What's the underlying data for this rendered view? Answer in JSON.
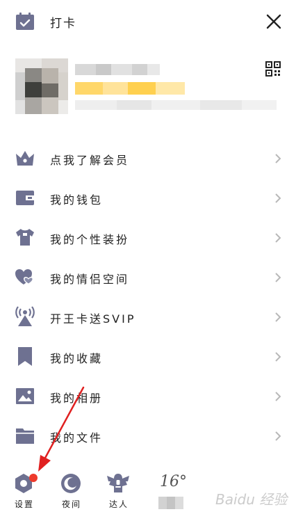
{
  "colors": {
    "icon": "#6e7191",
    "icon_light": "#8a8eab",
    "text": "#222222",
    "chevron": "#b8b8b8",
    "vip_gold": "#ffd76a",
    "badge_red": "#ee3a2c",
    "annotation_arrow": "#e02020"
  },
  "header": {
    "checkin_label": "打卡",
    "checkin_icon": "calendar-check-icon",
    "close_icon": "close-icon",
    "qr_icon": "qr-code-icon"
  },
  "menu": {
    "items": [
      {
        "label": "点我了解会员",
        "icon": "crown-icon"
      },
      {
        "label": "我的钱包",
        "icon": "wallet-icon"
      },
      {
        "label": "我的个性装扮",
        "icon": "shirt-icon"
      },
      {
        "label": "我的情侣空间",
        "icon": "hearts-icon"
      },
      {
        "label": "开王卡送SVIP",
        "icon": "signal-tower-icon"
      },
      {
        "label": "我的收藏",
        "icon": "bookmark-icon"
      },
      {
        "label": "我的相册",
        "icon": "photo-icon"
      },
      {
        "label": "我的文件",
        "icon": "folder-icon"
      }
    ]
  },
  "bottom": {
    "settings_label": "设置",
    "night_label": "夜间",
    "expert_label": "达人",
    "weather_temp": "16°"
  },
  "watermark": "Baidu 经验"
}
